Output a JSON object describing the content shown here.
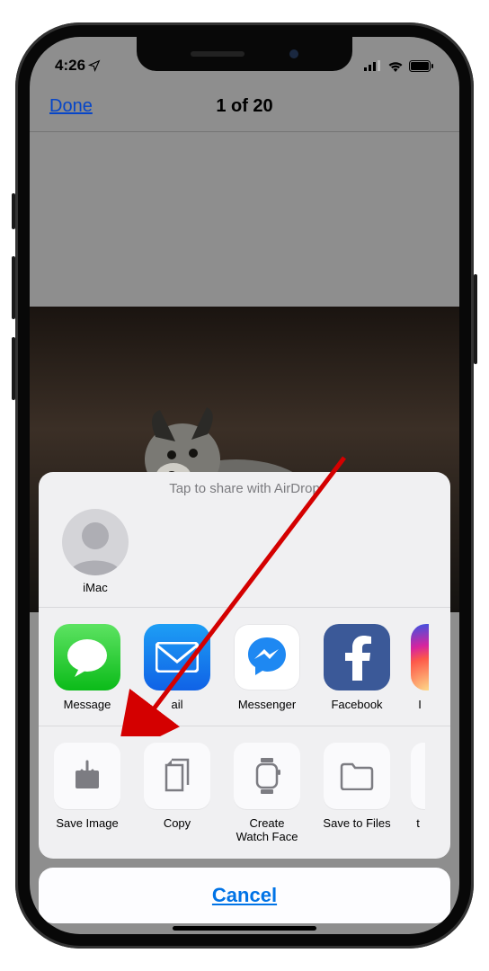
{
  "status": {
    "time": "4:26"
  },
  "nav": {
    "done": "Done",
    "counter": "1 of 20"
  },
  "sheet": {
    "airdrop_hint": "Tap to share with AirDrop",
    "airdrop_targets": [
      {
        "label": "iMac"
      }
    ],
    "apps": [
      {
        "label": "Message"
      },
      {
        "label": "Mail",
        "visible_label": "ail"
      },
      {
        "label": "Messenger"
      },
      {
        "label": "Facebook"
      },
      {
        "label": "Instagram",
        "visible_label": "I"
      }
    ],
    "actions": [
      {
        "label": "Save Image"
      },
      {
        "label": "Copy"
      },
      {
        "label": "Create\nWatch Face"
      },
      {
        "label": "Save to Files"
      },
      {
        "label": "",
        "visible_label": "t"
      }
    ],
    "cancel": "Cancel"
  }
}
